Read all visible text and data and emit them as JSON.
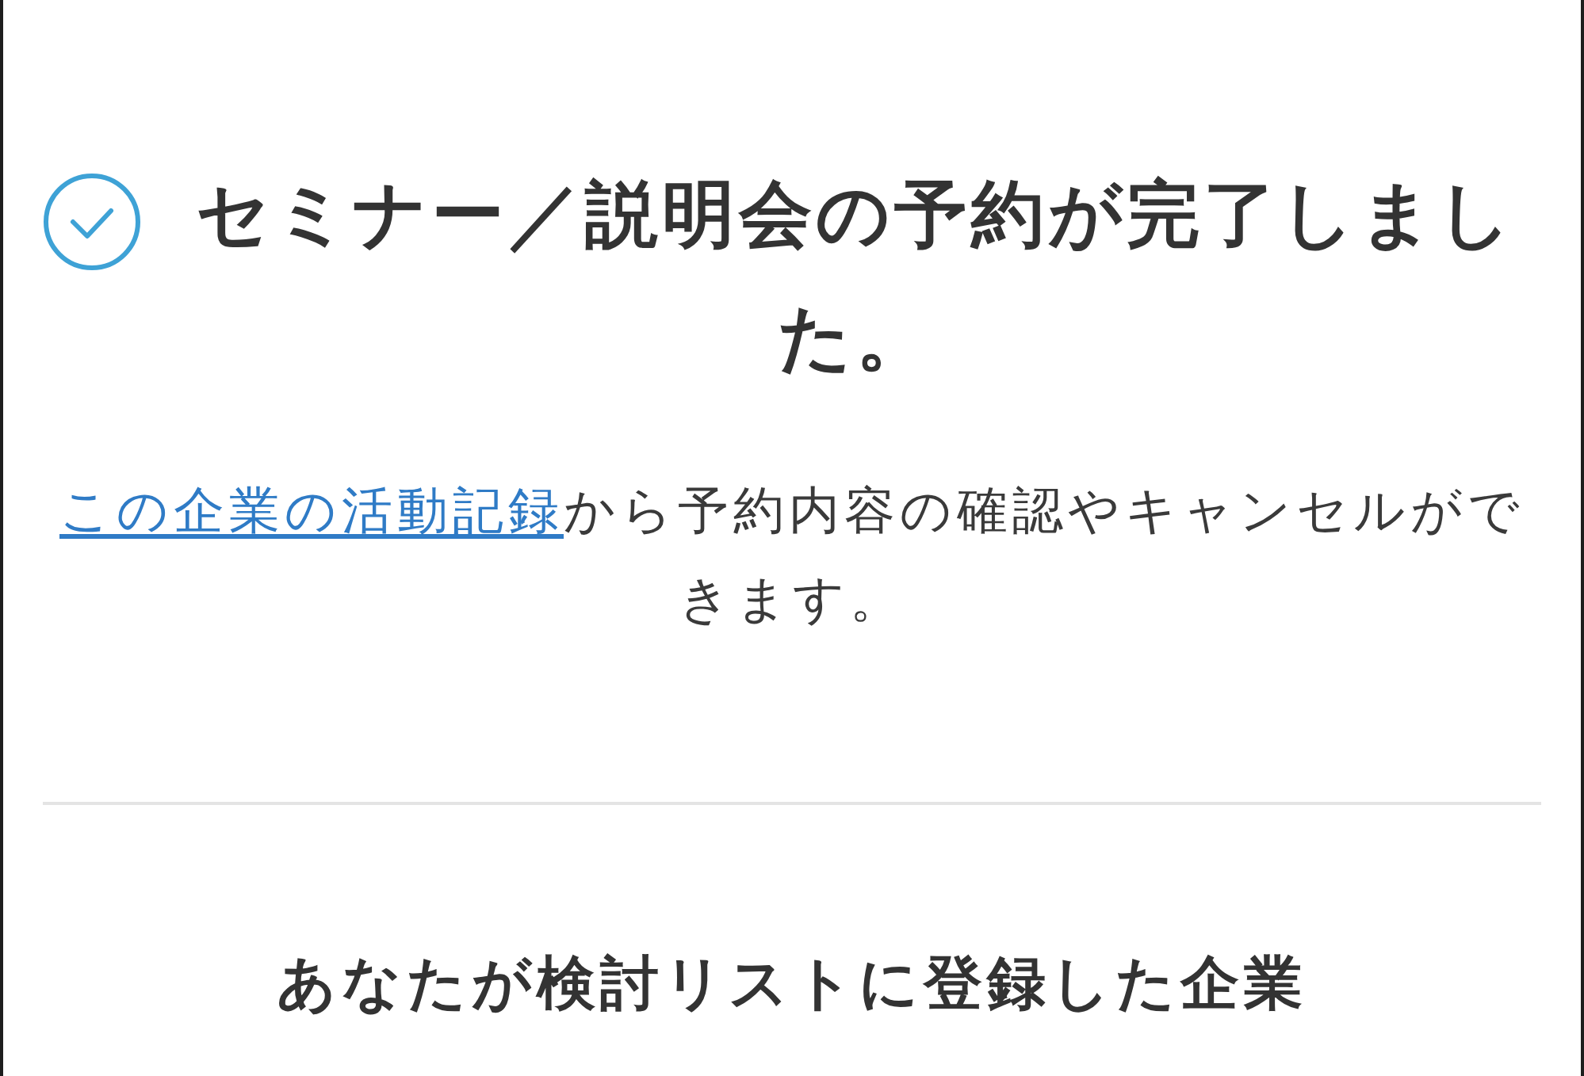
{
  "heading": {
    "text": "セミナー／説明会の予約が完了しました。"
  },
  "message": {
    "link": "この企業の活動記録",
    "text": "から予約内容の確認やキャンセルができます。"
  },
  "section": {
    "title": "あなたが検討リストに登録した企業"
  }
}
